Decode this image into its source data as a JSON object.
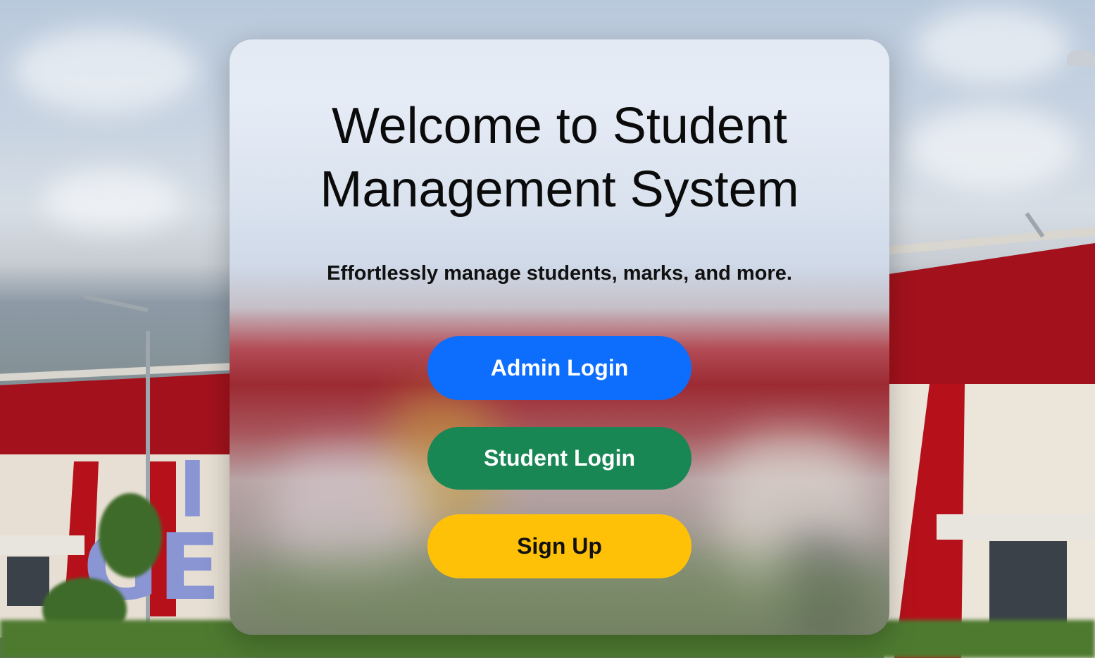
{
  "hero": {
    "title": "Welcome to Student Management System",
    "subtitle": "Effortlessly manage students, marks, and more."
  },
  "actions": {
    "admin_login": "Admin Login",
    "student_login": "Student Login",
    "sign_up": "Sign Up"
  },
  "colors": {
    "admin_button": "#0d6efd",
    "student_button": "#198754",
    "signup_button": "#ffc107"
  },
  "background": {
    "signage_letters": "I GE"
  }
}
